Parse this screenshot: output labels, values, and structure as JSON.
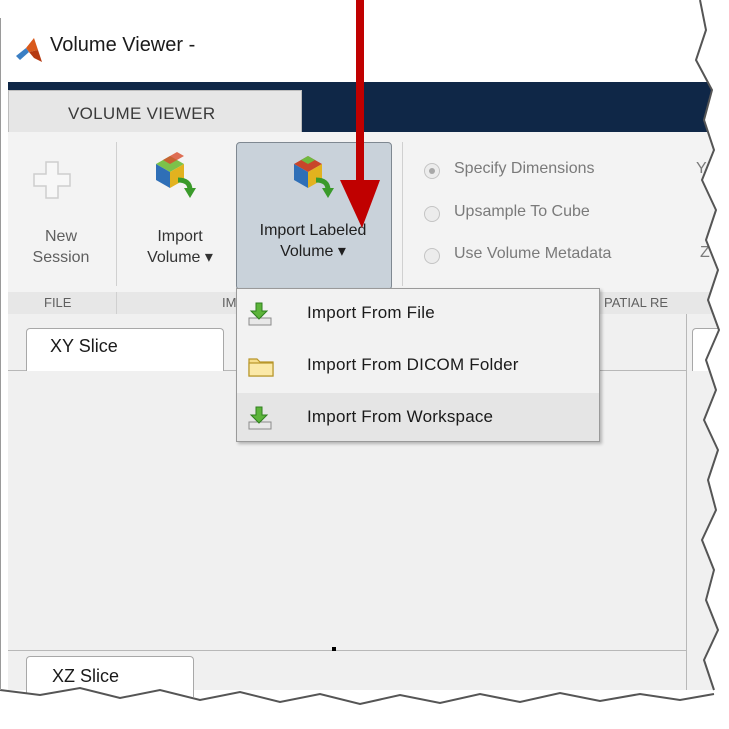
{
  "window": {
    "title": "Volume Viewer -"
  },
  "tabs": {
    "active": "VOLUME VIEWER"
  },
  "ribbon": {
    "new_session": {
      "line1": "New",
      "line2": "Session"
    },
    "import_volume": {
      "line1": "Import",
      "line2": "Volume"
    },
    "import_labeled": {
      "line1": "Import Labeled",
      "line2": "Volume"
    },
    "radios": [
      {
        "label": "Specify Dimensions",
        "selected": true
      },
      {
        "label": "Upsample To Cube",
        "selected": false
      },
      {
        "label": "Use Volume Metadata",
        "selected": false
      }
    ],
    "partial_right_1": "Y",
    "partial_right_2": "Z",
    "section_labels": {
      "file": "FILE",
      "import": "IM",
      "spatial": "PATIAL RE"
    }
  },
  "dropdown": {
    "items": [
      {
        "label": "Import From File",
        "icon": "green-down-arrow-icon"
      },
      {
        "label": "Import From DICOM Folder",
        "icon": "folder-icon"
      },
      {
        "label": "Import From Workspace",
        "icon": "green-down-arrow-icon"
      }
    ]
  },
  "panes": {
    "xy_tab": "XY Slice",
    "xz_tab": "XZ Slice"
  },
  "colors": {
    "tabstrip": "#0f2747",
    "arrow": "#c00000",
    "ribbon": "#f3f3f3",
    "pressed_button": "#c9d2da"
  }
}
